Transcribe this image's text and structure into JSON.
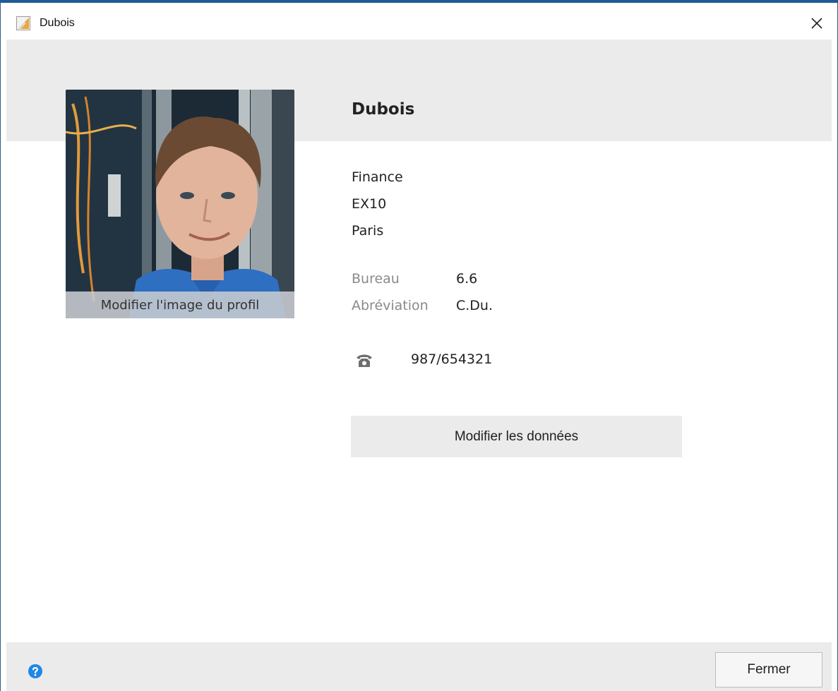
{
  "window": {
    "title": "Dubois",
    "close_icon": "close-icon",
    "app_icon": "app-logo-icon"
  },
  "profile": {
    "photo_caption": "Modifier l'image du profil",
    "name": "Dubois",
    "department": "Finance",
    "code": "EX10",
    "city": "Paris",
    "office_label": "Bureau",
    "office_value": "6.6",
    "abbrev_label": "Abréviation",
    "abbrev_value": "C.Du.",
    "phone_icon": "phone-icon",
    "phone": "987/654321",
    "edit_button": "Modifier les données"
  },
  "footer": {
    "help_icon": "help-icon",
    "close_button": "Fermer"
  },
  "colors": {
    "band": "#ebebeb",
    "window_border": "#1f5a96",
    "help": "#1e88e5"
  }
}
